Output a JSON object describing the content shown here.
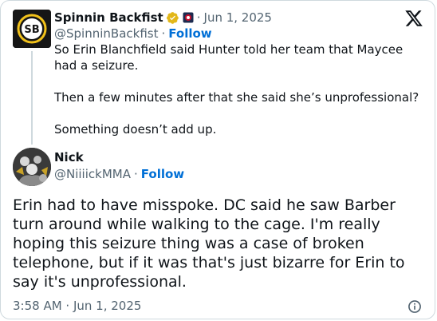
{
  "parent": {
    "name": "Spinnin Backfist",
    "handle": "@SpinninBackfist",
    "follow_label": "Follow",
    "date": "Jun 1, 2025",
    "avatar_initials": "SB",
    "text": "So Erin Blanchfield said Hunter told her team that Maycee had a seizure.\n\nThen a few minutes after that she said she’s unprofessional?\n\nSomething doesn’t add up."
  },
  "reply": {
    "name": "Nick",
    "handle": "@NiiiickMMA",
    "follow_label": "Follow",
    "text": "Erin had to have misspoke. DC said he saw Barber turn around while walking to the cage. I'm really hoping this seizure thing was a case of broken telephone, but if it was that's just bizarre for Erin to say it's unprofessional.",
    "timestamp": "3:58 AM · Jun 1, 2025"
  },
  "separator": "·",
  "icons": {
    "brand": "x-logo-icon",
    "verified": "verified-badge-icon",
    "affiliate": "affiliate-badge-icon",
    "info": "info-icon"
  },
  "colors": {
    "follow": "#006fd6",
    "muted": "#536471",
    "verified_gold": "#e2b719",
    "border": "#cfd9de"
  }
}
